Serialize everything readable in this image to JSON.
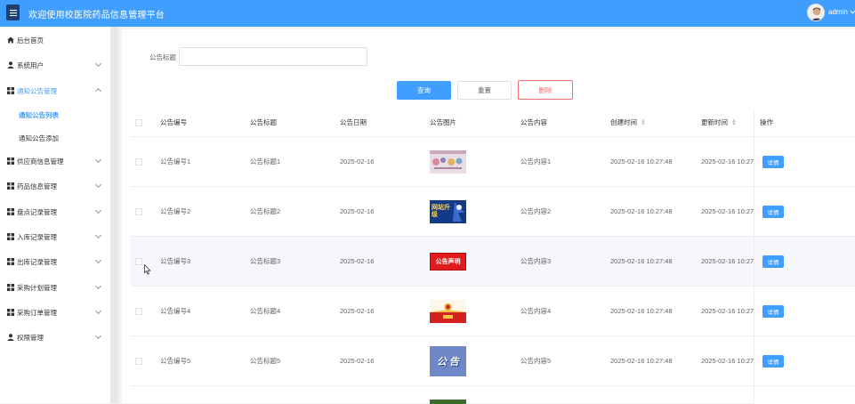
{
  "header": {
    "title": "欢迎使用校医院药品信息管理平台",
    "menu_icon": "menu-icon",
    "user": "admin"
  },
  "sidebar": {
    "items": [
      {
        "label": "后台首页",
        "icon": "home-icon"
      },
      {
        "label": "系统用户",
        "icon": "user-icon"
      },
      {
        "label": "通知公告管理",
        "icon": "grid-icon"
      },
      {
        "label": "供应商信息管理",
        "icon": "grid-icon"
      },
      {
        "label": "药品信息管理",
        "icon": "grid-icon"
      },
      {
        "label": "盘点记录管理",
        "icon": "grid-icon"
      },
      {
        "label": "入库记录管理",
        "icon": "grid-icon"
      },
      {
        "label": "出库记录管理",
        "icon": "grid-icon"
      },
      {
        "label": "采购计划管理",
        "icon": "grid-icon"
      },
      {
        "label": "采购订单管理",
        "icon": "grid-icon"
      },
      {
        "label": "权限管理",
        "icon": "user-icon"
      }
    ],
    "sub_items": [
      {
        "label": "通知公告列表",
        "active": true
      },
      {
        "label": "通知公告添加",
        "active": false
      }
    ]
  },
  "filter": {
    "label": "公告标题",
    "value": "",
    "placeholder": ""
  },
  "buttons": {
    "query": "查询",
    "reset": "重置",
    "delete": "删除"
  },
  "table": {
    "columns": [
      "公告编号",
      "公告标题",
      "公告日期",
      "公告图片",
      "公告内容",
      "创建时间",
      "更新时间",
      "操作"
    ],
    "detail_label": "详情",
    "rows": [
      {
        "code": "公告编号1",
        "title": "公告标题1",
        "date": "2025-02-16",
        "content": "公告内容1",
        "created": "2025-02-16 10:27:48",
        "updated": "2025-02-16 10:27:",
        "image_text": ""
      },
      {
        "code": "公告编号2",
        "title": "公告标题2",
        "date": "2025-02-16",
        "content": "公告内容2",
        "created": "2025-02-16 10:27:48",
        "updated": "2025-02-16 10:27:",
        "image_text": "网站升级"
      },
      {
        "code": "公告编号3",
        "title": "公告标题3",
        "date": "2025-02-16",
        "content": "公告内容3",
        "created": "2025-02-16 10:27:48",
        "updated": "2025-02-16 10:27:",
        "image_text": "公告声明"
      },
      {
        "code": "公告编号4",
        "title": "公告标题4",
        "date": "2025-02-16",
        "content": "公告内容4",
        "created": "2025-02-16 10:27:48",
        "updated": "2025-02-16 10:27:",
        "image_text": ""
      },
      {
        "code": "公告编号5",
        "title": "公告标题5",
        "date": "2025-02-16",
        "content": "公告内容5",
        "created": "2025-02-16 10:27:48",
        "updated": "2025-02-16 10:27:",
        "image_text": "公 告"
      }
    ]
  },
  "colors": {
    "primary": "#409eff",
    "danger": "#f56c6c",
    "menu_button": "#1d3f72"
  }
}
